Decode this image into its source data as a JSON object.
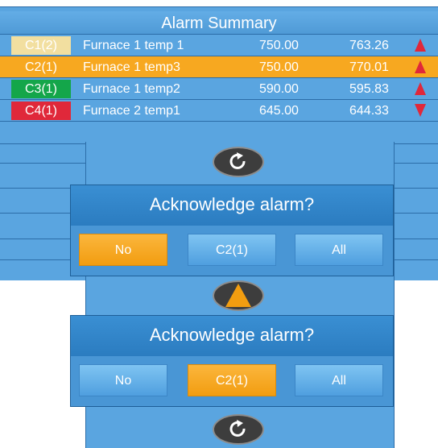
{
  "title": "Alarm Summary",
  "alarms": [
    {
      "tag": "C1(2)",
      "name": "Furnace 1 temp 1",
      "setpoint": "750.00",
      "value": "763.26",
      "direction": "up",
      "tag_color": "#f2dfa0",
      "arrow_color": "#e0283a"
    },
    {
      "tag": "C2(1)",
      "name": "Furnace 1 temp3",
      "setpoint": "750.00",
      "value": "770.01",
      "direction": "up",
      "tag_color": "#f7a820",
      "arrow_color": "#e0283a",
      "selected": true
    },
    {
      "tag": "C3(1)",
      "name": "Furnace 1 temp2",
      "setpoint": "590.00",
      "value": "595.83",
      "direction": "up",
      "tag_color": "#14a64a",
      "arrow_color": "#e0283a"
    },
    {
      "tag": "C4(1)",
      "name": "Furnace 2 temp1",
      "setpoint": "645.00",
      "value": "644.33",
      "direction": "down",
      "tag_color": "#e0283a",
      "arrow_color": "#e0283a"
    }
  ],
  "refresh_icon": "refresh-icon",
  "nav_icon": "triangle-up-icon",
  "dialogs": [
    {
      "title": "Acknowledge alarm?",
      "buttons": [
        "No",
        "C2(1)",
        "All"
      ],
      "active": 0
    },
    {
      "title": "Acknowledge alarm?",
      "buttons": [
        "No",
        "C2(1)",
        "All"
      ],
      "active": 1
    }
  ],
  "colors": {
    "panel": "#5aa5e0",
    "selected": "#f7a820",
    "dialog": "#2f82c7",
    "button": "#6fb6ea"
  }
}
